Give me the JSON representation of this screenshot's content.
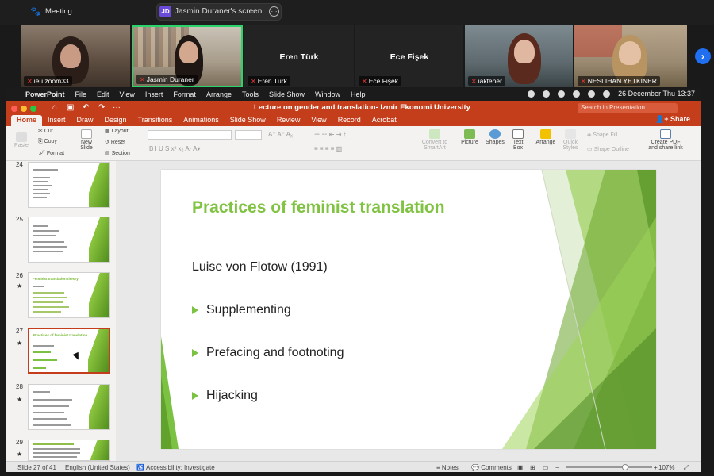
{
  "zoom": {
    "meeting_label": "Meeting",
    "share_initials": "JD",
    "share_text": "Jasmin Duraner's screen",
    "participants": [
      {
        "name": "ieu zoom33"
      },
      {
        "name": "Jasmin Duraner"
      },
      {
        "name": "Eren Türk",
        "display": "Eren Türk"
      },
      {
        "name": "Ece Fişek",
        "display": "Ece Fişek"
      },
      {
        "name": "iaktener"
      },
      {
        "name": "NESLIHAN YETKINER"
      }
    ],
    "next_glyph": "›"
  },
  "mac_menu": {
    "items": [
      "PowerPoint",
      "File",
      "Edit",
      "View",
      "Insert",
      "Format",
      "Arrange",
      "Tools",
      "Slide Show",
      "Window",
      "Help"
    ],
    "clock": "26 December Thu  13:37"
  },
  "ppt": {
    "title": "Lecture on gender and translation- Izmir Ekonomi University",
    "search_placeholder": "Search in Presentation",
    "share_label": "Share",
    "tabs": [
      "Home",
      "Insert",
      "Draw",
      "Design",
      "Transitions",
      "Animations",
      "Slide Show",
      "Review",
      "View",
      "Record",
      "Acrobat"
    ],
    "active_tab": "Home",
    "ribbon": {
      "paste": "Paste",
      "cut": "Cut",
      "copy": "Copy",
      "format": "Format",
      "new_slide": "New Slide",
      "layout": "Layout",
      "reset": "Reset",
      "section": "Section",
      "convert": "Convert to SmartArt",
      "picture": "Picture",
      "shapes": "Shapes",
      "textbox": "Text Box",
      "arrange": "Arrange",
      "quick_styles": "Quick Styles",
      "shape_fill": "Shape Fill",
      "shape_outline": "Shape Outline",
      "create_pdf": "Create PDF and share link"
    },
    "slide_numbers": [
      "24",
      "25",
      "26",
      "27",
      "28",
      "29"
    ],
    "thumb_titles": [
      "",
      "",
      "Feminist translation theory",
      "Practices of feminist translation",
      "",
      ""
    ],
    "slide": {
      "title": "Practices of feminist translation",
      "subtitle": "Luise von Flotow (1991)",
      "bullets": [
        "Supplementing",
        "Prefacing and footnoting",
        "Hijacking"
      ]
    },
    "status": {
      "slide_of": "Slide 27 of 41",
      "language": "English (United States)",
      "accessibility": "Accessibility: Investigate",
      "notes": "Notes",
      "comments": "Comments",
      "zoom": "107%"
    },
    "colors": {
      "accent": "#c43e1c",
      "slide_green": "#80c342"
    }
  }
}
